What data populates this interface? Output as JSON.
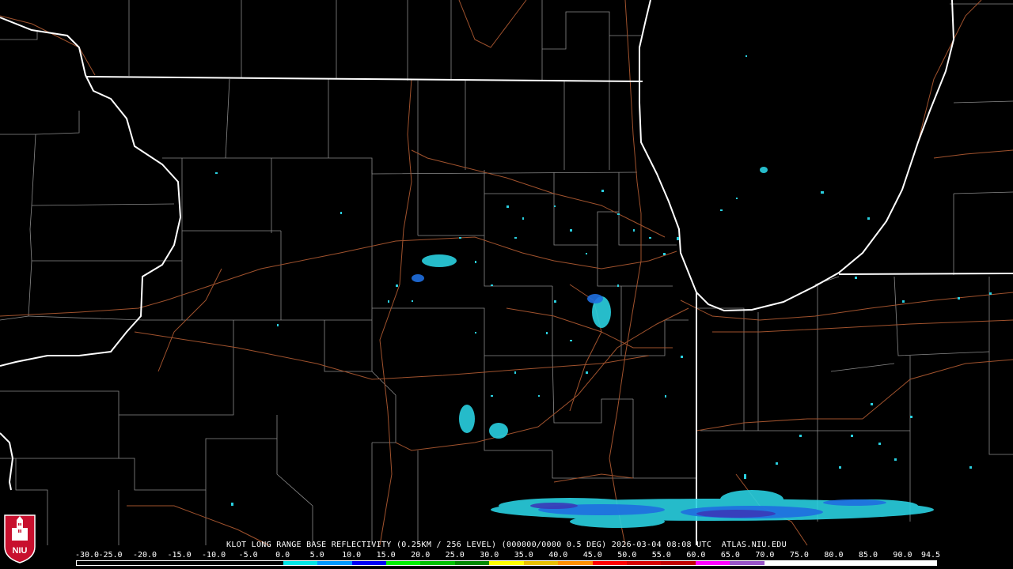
{
  "product": {
    "caption": "KLOT LONG RANGE BASE REFLECTIVITY (0.25KM / 256 LEVEL) (000000/0000 0.5 DEG) 2026-03-04 08:08 UTC  ATLAS.NIU.EDU"
  },
  "logo": {
    "text": "NIU",
    "icon": "niu-tower-icon",
    "color": "#c8102e"
  },
  "scale": {
    "labels": [
      "-30.0",
      "-25.0",
      "-20.0",
      "-15.0",
      "-10.0",
      "-5.0",
      "0.0",
      "5.0",
      "10.0",
      "15.0",
      "20.0",
      "25.0",
      "30.0",
      "35.0",
      "40.0",
      "45.0",
      "50.0",
      "55.0",
      "60.0",
      "65.0",
      "70.0",
      "75.0",
      "80.0",
      "85.0",
      "90.0",
      "94.5"
    ],
    "colors": [
      "#000000",
      "#000000",
      "#000000",
      "#000000",
      "#000000",
      "#000000",
      "#00e6e6",
      "#0099ff",
      "#0000f6",
      "#00f000",
      "#00c000",
      "#008800",
      "#ffff00",
      "#e7c000",
      "#ff9000",
      "#ff0000",
      "#d60000",
      "#c00000",
      "#ff00ff",
      "#9955c9",
      "#ffffff",
      "#ffffff",
      "#ffffff",
      "#ffffff",
      "#ffffff"
    ]
  },
  "colors": {
    "state_lines": "#ffffff",
    "county_lines": "#8a8a8a",
    "highways": "#a0522d",
    "echo_light": "#2ad0e0",
    "echo_medium": "#1f6fe0",
    "echo_dark": "#3a3ab8"
  }
}
